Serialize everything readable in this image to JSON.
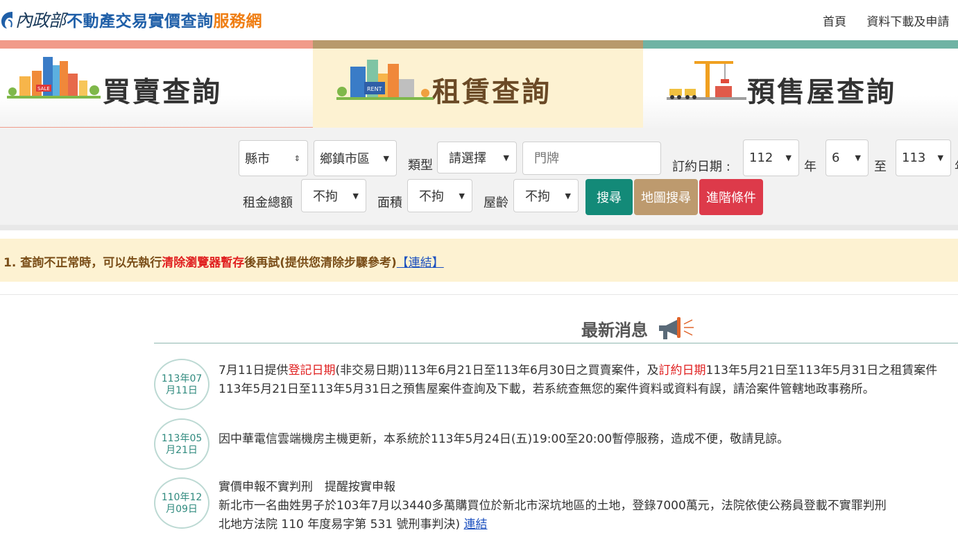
{
  "header": {
    "logo_moi": "內政部",
    "logo_title": "不動產交易實價查詢",
    "logo_sub": "服務網",
    "nav": [
      "首頁",
      "資料下載及申請"
    ]
  },
  "tabs": [
    {
      "label": "買賣查詢",
      "badge": "SALE"
    },
    {
      "label": "租賃查詢",
      "badge": "RENT"
    },
    {
      "label": "預售屋查詢"
    }
  ],
  "search": {
    "county": "縣市",
    "district": "鄉鎮市區",
    "type_label": "類型",
    "type_value": "請選擇",
    "door_placeholder": "門牌",
    "date_label": "訂約日期 :",
    "year_from": "112",
    "year_unit": "年",
    "month_from": "6",
    "to_label": "至",
    "year_to": "113",
    "year_unit2": "年",
    "rent_label": "租金總額",
    "rent_value": "不拘",
    "area_label": "面積",
    "area_value": "不拘",
    "age_label": "屋齡",
    "age_value": "不拘",
    "btn_search": "搜尋",
    "btn_map": "地圖搜尋",
    "btn_advanced": "進階條件"
  },
  "notice": {
    "prefix": "1. 查詢不正常時，可以先執行",
    "highlight": "清除瀏覽器暫存",
    "suffix": "後再試(提供您清除步驟參考)",
    "link": "【連結】"
  },
  "news": {
    "title": "最新消息",
    "items": [
      {
        "date1": "113年07",
        "date2": "月11日",
        "l1a": "7月11日提供",
        "l1b": "登記日期",
        "l1c": "(非交易日期)113年6月21日至113年6月30日之買賣案件，及",
        "l1d": "訂約日期",
        "l1e": "113年5月21日至113年5月31日之租賃案件",
        "l2": "113年5月21日至113年5月31日之預售屋案件查詢及下載，若系統查無您的案件資料或資料有誤，請洽案件管轄地政事務所。"
      },
      {
        "date1": "113年05",
        "date2": "月21日",
        "l1": "因中華電信雲端機房主機更新，本系統於113年5月24日(五)19:00至20:00暫停服務，造成不便，敬請見諒。"
      },
      {
        "date1": "110年12",
        "date2": "月09日",
        "l1": "實價申報不實判刑　提醒按實申報",
        "l2": "新北市一名曲姓男子於103年7月以3440多萬購買位於新北市深坑地區的土地，登錄7000萬元，法院依使公務員登載不實罪判刑",
        "l3": "北地方法院 110 年度易字第 531 號刑事判決)",
        "link": "連結"
      }
    ]
  },
  "colors": {
    "sale_bar": "#f19b8a",
    "rent_bar": "#b89a6c",
    "presale_bar": "#6fb3a4",
    "btn_search": "#138a78",
    "btn_map": "#bd9a6e",
    "btn_advanced": "#dd3a4a",
    "notice_bg": "#fdf2d2"
  }
}
